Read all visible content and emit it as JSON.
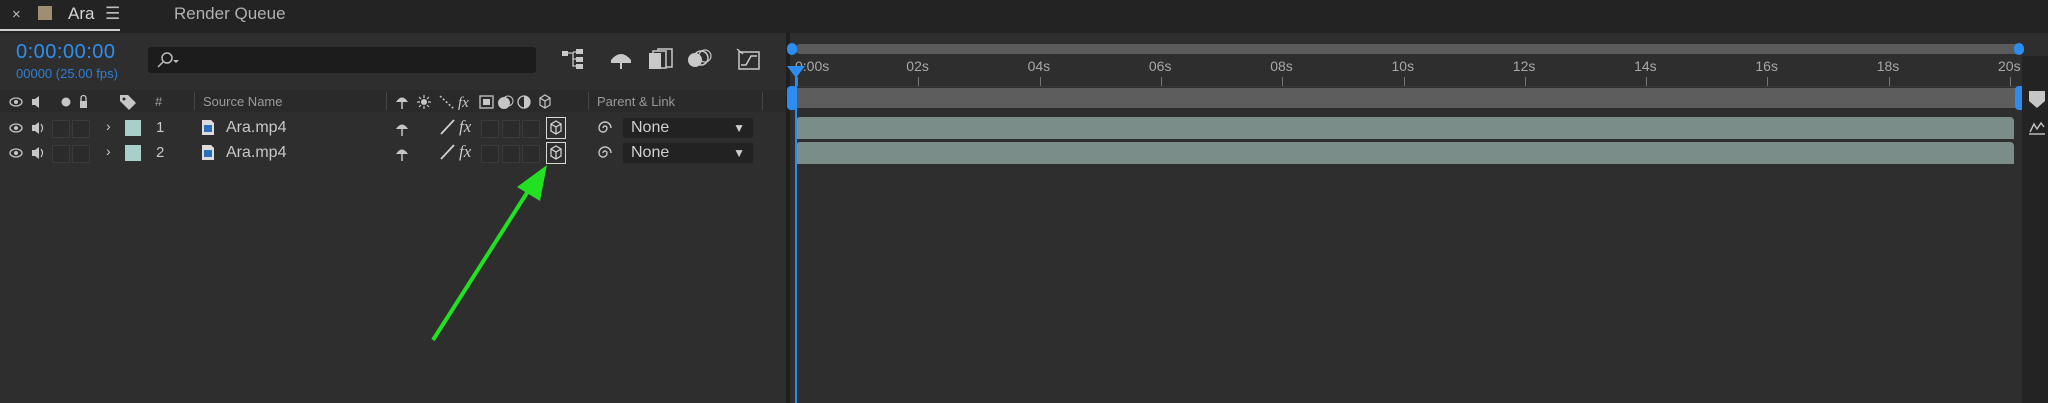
{
  "tabs": {
    "comp_name": "Ara",
    "close": "×",
    "menu": "☰",
    "render_queue": "Render Queue"
  },
  "time": {
    "timecode": "0:00:00:00",
    "frame_info": "00000 (25.00 fps)"
  },
  "header": {
    "hash": "#",
    "source_name": "Source Name",
    "parent_link": "Parent & Link",
    "fx": "fx"
  },
  "layers": [
    {
      "num": "1",
      "name": "Ara.mp4",
      "parent": "None"
    },
    {
      "num": "2",
      "name": "Ara.mp4",
      "parent": "None"
    }
  ],
  "ruler": {
    "ticks": [
      "0:00s",
      "02s",
      "04s",
      "06s",
      "08s",
      "10s",
      "12s",
      "14s",
      "16s",
      "18s",
      "20s"
    ]
  },
  "colors": {
    "accent": "#2d8cf0",
    "label": "#a8cfc9",
    "clip": "#7a8d88",
    "annotation_arrow": "#22e022"
  }
}
